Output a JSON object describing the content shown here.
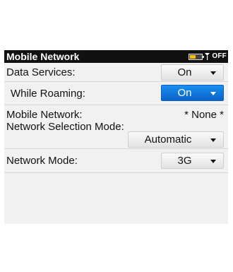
{
  "title": "Mobile Network",
  "status": {
    "battery_level": 0.5,
    "radio_label": "OFF",
    "battery_icon": "battery-icon",
    "antenna_icon": "antenna-icon"
  },
  "settings": {
    "data_services": {
      "label": "Data Services:",
      "value": "On"
    },
    "while_roaming": {
      "label": "While Roaming:",
      "value": "On"
    },
    "mobile_network": {
      "label": "Mobile Network:",
      "value": "* None *"
    },
    "network_selection_mode": {
      "label": "Network Selection Mode:",
      "value": "Automatic"
    },
    "network_mode": {
      "label": "Network Mode:",
      "value": "3G"
    }
  },
  "colors": {
    "accent": "#1b8ff0",
    "titlebar": "#111111",
    "battery_fill": "#f2c200"
  }
}
